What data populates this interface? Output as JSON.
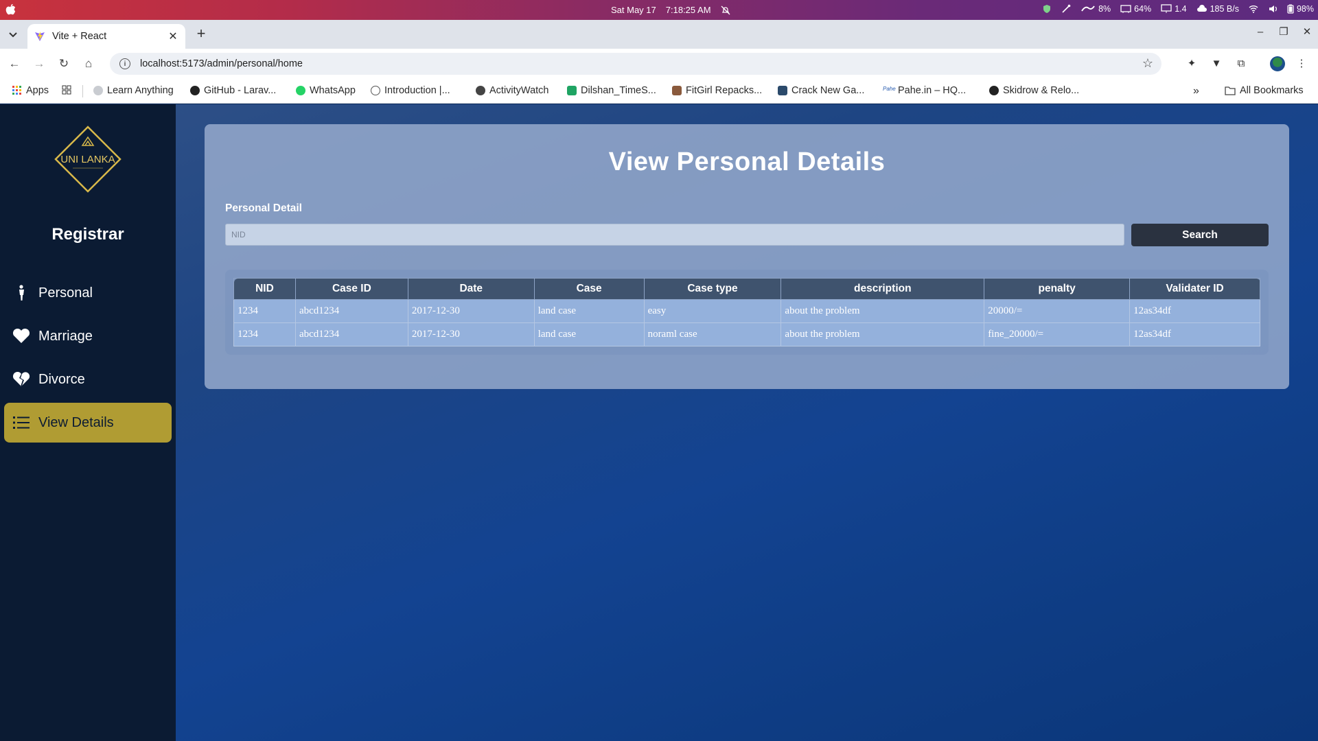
{
  "os": {
    "date": "Sat May 17",
    "time": "7:18:25 AM",
    "tray": {
      "cpu": "8%",
      "mem": "64%",
      "load": "1.4",
      "net": "185 B/s",
      "battery": "98%"
    }
  },
  "browser": {
    "tab_title": "Vite + React",
    "url": "localhost:5173/admin/personal/home",
    "bookmarks": [
      {
        "label": "Apps",
        "icon": "apps-grid-icon"
      },
      {
        "label": "Learn Anything",
        "icon": "globe-icon"
      },
      {
        "label": "GitHub - Larav...",
        "icon": "github-icon"
      },
      {
        "label": "WhatsApp",
        "icon": "whatsapp-icon"
      },
      {
        "label": "Introduction |...",
        "icon": "docs-icon"
      },
      {
        "label": "ActivityWatch",
        "icon": "activitywatch-icon"
      },
      {
        "label": "Dilshan_TimeS...",
        "icon": "sheets-icon"
      },
      {
        "label": "FitGirl Repacks...",
        "icon": "fitgirl-icon"
      },
      {
        "label": "Crack New Ga...",
        "icon": "crack-icon"
      },
      {
        "label": "Pahe.in – HQ...",
        "icon": "pahe-icon"
      },
      {
        "label": "Skidrow & Relo...",
        "icon": "skidrow-icon"
      }
    ],
    "all_bookmarks": "All Bookmarks"
  },
  "sidebar": {
    "logo_text": "UNI LANKA",
    "role": "Registrar",
    "items": [
      {
        "label": "Personal",
        "icon": "person-icon",
        "active": false
      },
      {
        "label": "Marriage",
        "icon": "heart-icon",
        "active": false
      },
      {
        "label": "Divorce",
        "icon": "broken-heart-icon",
        "active": false
      },
      {
        "label": "View Details",
        "icon": "list-icon",
        "active": true
      }
    ]
  },
  "main": {
    "title": "View Personal Details",
    "field_label": "Personal Detail",
    "search_placeholder": "NID",
    "search_button": "Search",
    "table": {
      "headers": [
        "NID",
        "Case ID",
        "Date",
        "Case",
        "Case type",
        "description",
        "penalty",
        "Validater ID"
      ],
      "rows": [
        [
          "1234",
          "abcd1234",
          "2017-12-30",
          "land case",
          "easy",
          "about the problem",
          "20000/=",
          "12as34df"
        ],
        [
          "1234",
          "abcd1234",
          "2017-12-30",
          "land case",
          "noraml case",
          "about the problem",
          "fine_20000/=",
          "12as34df"
        ]
      ]
    }
  },
  "colors": {
    "sidebar_bg": "#0b1b33",
    "active_item": "#b09c33",
    "panel": "#96aacd",
    "table_header": "#3f536e",
    "table_cell": "#94b1dc",
    "search_button": "#2a3240"
  }
}
